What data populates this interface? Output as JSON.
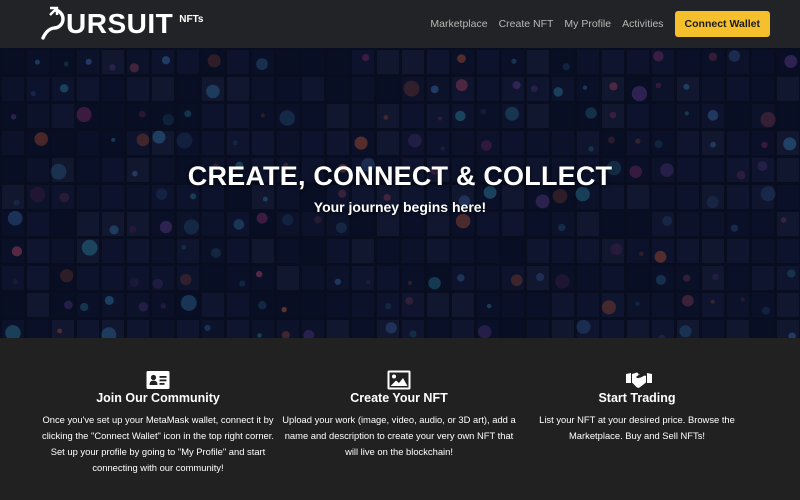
{
  "nav": {
    "brand_word": "URSUIT",
    "brand_sub": "NFTs",
    "links": [
      "Marketplace",
      "Create NFT",
      "My Profile",
      "Activities"
    ],
    "cta": "Connect Wallet"
  },
  "hero": {
    "title": "CREATE, CONNECT & COLLECT",
    "subtitle": "Your journey begins here!"
  },
  "features": [
    {
      "icon": "id-card-icon",
      "title": "Join Our Community",
      "body": "Once you've set up your MetaMask wallet, connect it by clicking the \"Connect Wallet\" icon in the top right corner. Set up your profile by going to \"My Profile\" and start connecting with our community!"
    },
    {
      "icon": "image-icon",
      "title": "Create Your NFT",
      "body": "Upload your work (image, video, audio, or 3D art), add a name and description to create your very own NFT that will live on the blockchain!"
    },
    {
      "icon": "handshake-icon",
      "title": "Start Trading",
      "body": "List your NFT at your desired price. Browse the Marketplace. Buy and Sell NFTs!"
    }
  ],
  "colors": {
    "cta": "#f6c02d",
    "nav_bg": "#222326",
    "page_bg": "#212121",
    "hero_bg": "#0a1022"
  }
}
